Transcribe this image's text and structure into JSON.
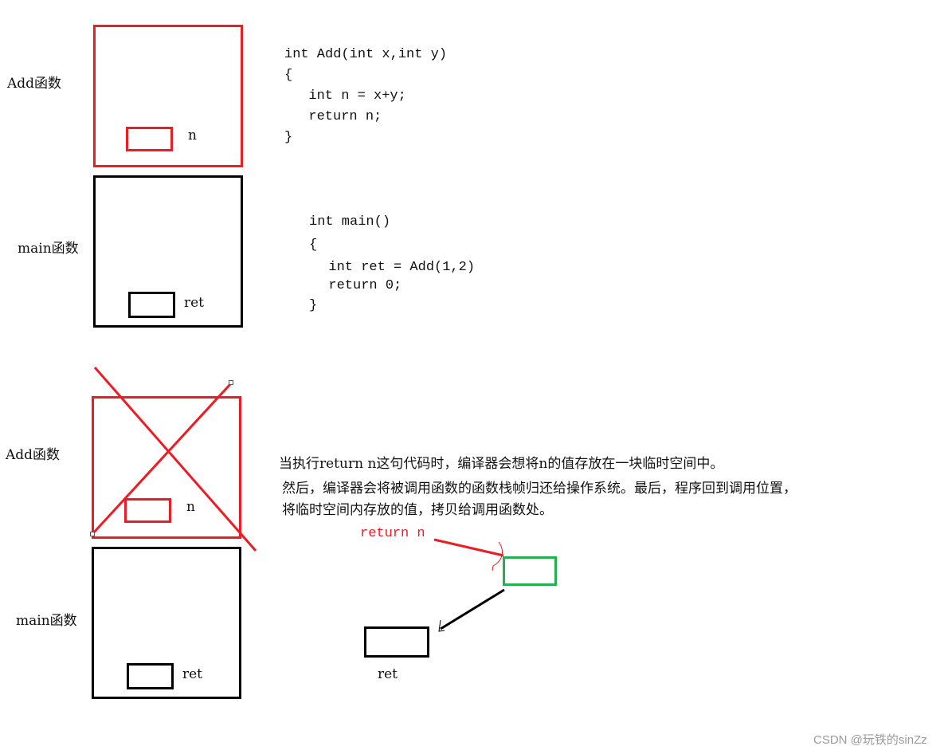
{
  "top_section": {
    "add_frame_label": "Add函数",
    "add_var_label": "n",
    "main_frame_label": "main函数",
    "main_var_label": "ret",
    "add_code": [
      "int Add(int x,int y)",
      "{",
      "  int n = x+y;",
      "  return n;",
      "}"
    ],
    "main_code": [
      "int main()",
      "{",
      "  int ret = Add(1,2)",
      "  return 0;",
      "}"
    ]
  },
  "bottom_section": {
    "add_frame_label": "Add函数",
    "add_var_label": "n",
    "main_frame_label": "main函数",
    "main_var_label": "ret",
    "explanation": [
      "当执行return n这句代码时，编译器会想将n的值存放在一块临时空间中。",
      "然后，编译器会将被调用函数的函数栈帧归还给操作系统。最后，程序回到调用位置，",
      "将临时空间内存放的值，拷贝给调用函数处。"
    ],
    "return_label": "return n",
    "ret_label": "ret"
  },
  "colors": {
    "callee_frame": "#ed1c24",
    "caller_frame": "#000000",
    "temp_space": "#22b14c"
  },
  "watermark": "CSDN @玩铁的sinZz"
}
